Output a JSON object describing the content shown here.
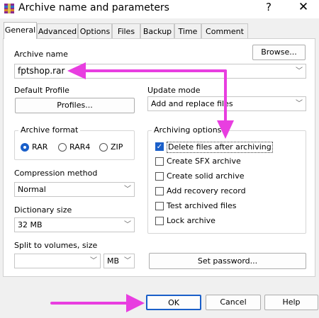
{
  "window": {
    "title": "Archive name and parameters",
    "help_label": "?",
    "close_label": "✕"
  },
  "tabs": [
    "General",
    "Advanced",
    "Options",
    "Files",
    "Backup",
    "Time",
    "Comment"
  ],
  "archive_name": {
    "label": "Archive name",
    "value": "fptshop.rar",
    "browse_label": "Browse..."
  },
  "default_profile": {
    "label": "Default Profile",
    "button_label": "Profiles..."
  },
  "update_mode": {
    "label": "Update mode",
    "value": "Add and replace files"
  },
  "archive_format": {
    "label": "Archive format",
    "options": [
      "RAR",
      "RAR4",
      "ZIP"
    ],
    "selected": "RAR"
  },
  "archiving_options": {
    "label": "Archiving options",
    "items": [
      {
        "label": "Delete files after archiving",
        "checked": true
      },
      {
        "label": "Create SFX archive",
        "checked": false
      },
      {
        "label": "Create solid archive",
        "checked": false
      },
      {
        "label": "Add recovery record",
        "checked": false
      },
      {
        "label": "Test archived files",
        "checked": false
      },
      {
        "label": "Lock archive",
        "checked": false
      }
    ]
  },
  "compression_method": {
    "label": "Compression method",
    "value": "Normal"
  },
  "dictionary_size": {
    "label": "Dictionary size",
    "value": "32 MB"
  },
  "split_volumes": {
    "label": "Split to volumes, size",
    "value": "",
    "unit": "MB"
  },
  "set_password_label": "Set password...",
  "footer": {
    "ok_label": "OK",
    "cancel_label": "Cancel",
    "help_label": "Help"
  },
  "colors": {
    "accent": "#1a5fc9",
    "annotation_arrow": "#e83ee0"
  },
  "icons": [
    "winrar-icon",
    "chevron-down-icon",
    "checkmark-icon",
    "arrow-annotation"
  ]
}
